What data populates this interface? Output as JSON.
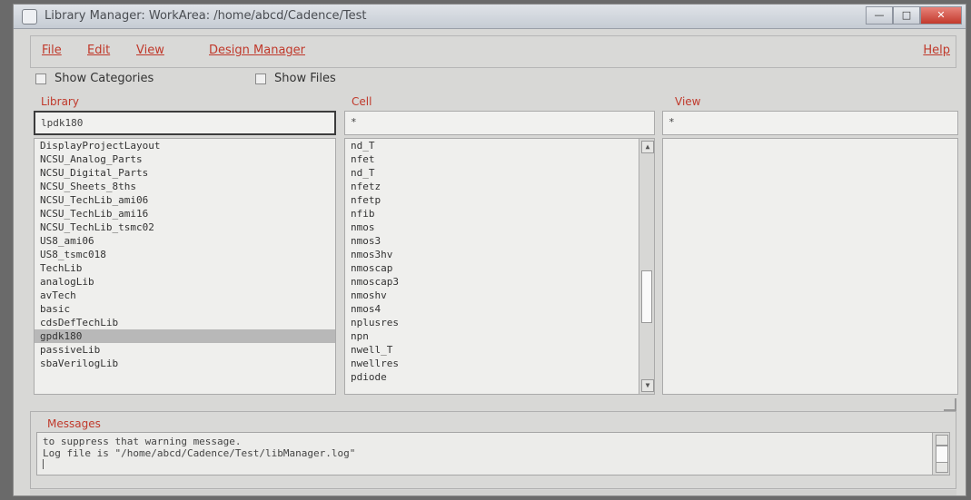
{
  "window": {
    "title": "Library Manager: WorkArea: /home/abcd/Cadence/Test",
    "controls": {
      "minimize": "—",
      "maximize": "□",
      "close": "✕"
    }
  },
  "menu": {
    "file": "File",
    "edit": "Edit",
    "view": "View",
    "design_manager": "Design Manager",
    "help": "Help"
  },
  "toggles": {
    "show_categories": "Show Categories",
    "show_files": "Show Files"
  },
  "library": {
    "label": "Library",
    "filter_value": "lpdk180",
    "items": [
      "DisplayProjectLayout",
      "NCSU_Analog_Parts",
      "NCSU_Digital_Parts",
      "NCSU_Sheets_8ths",
      "NCSU_TechLib_ami06",
      "NCSU_TechLib_ami16",
      "NCSU_TechLib_tsmc02",
      "US8_ami06",
      "US8_tsmc018",
      "TechLib",
      "analogLib",
      "avTech",
      "basic",
      "cdsDefTechLib",
      "gpdk180",
      "passiveLib",
      "sbaVerilogLib"
    ],
    "selected_index": 14
  },
  "cell": {
    "label": "Cell",
    "filter_value": "*",
    "items": [
      "nd_T",
      "nfet",
      "nd_T",
      "nfetz",
      "nfetp",
      "nfib",
      "nmos",
      "nmos3",
      "nmos3hv",
      "nmoscap",
      "nmoscap3",
      "nmoshv",
      "nmos4",
      "nplusres",
      "npn",
      "nwell_T",
      "nwellres",
      "pdiode"
    ]
  },
  "view": {
    "label": "View",
    "filter_value": "*"
  },
  "messages": {
    "label": "Messages",
    "lines": [
      "to suppress that warning message.",
      "Log file is \"/home/abcd/Cadence/Test/libManager.log\""
    ]
  }
}
